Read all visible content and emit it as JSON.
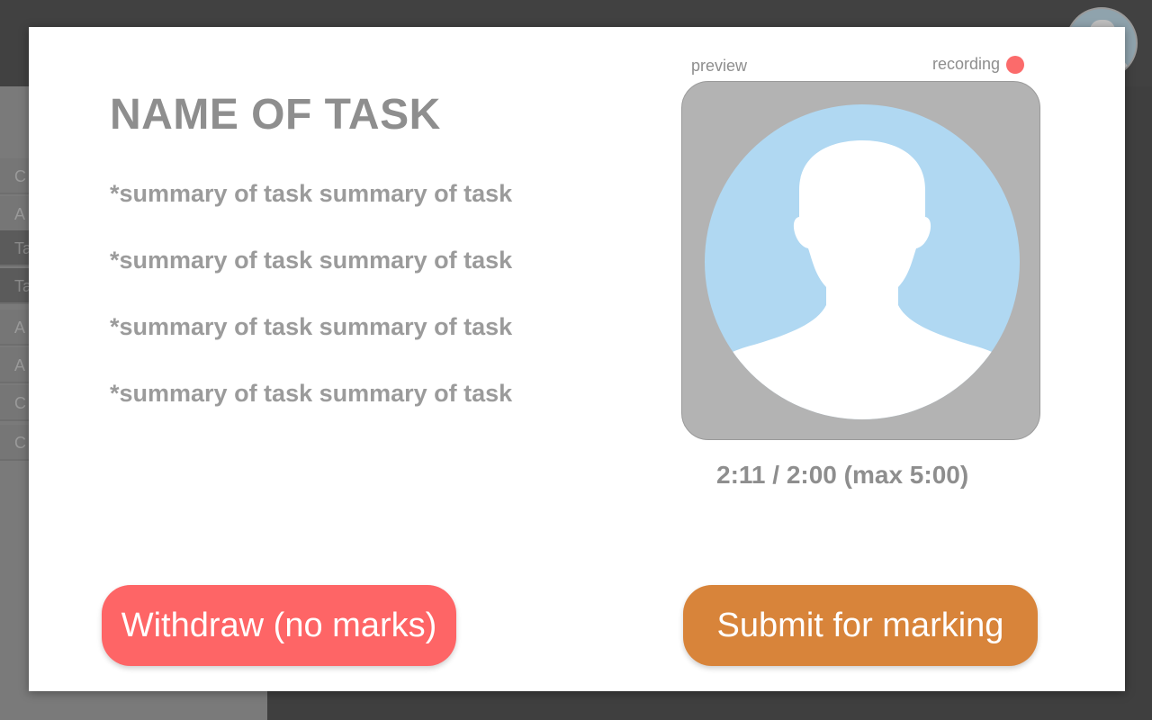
{
  "background": {
    "sidebar_items": [
      {
        "label": "C",
        "active": false
      },
      {
        "label": "A",
        "active": false
      },
      {
        "label": "Ta",
        "active": true
      },
      {
        "label": "Ta",
        "active": true
      },
      {
        "label": "A",
        "active": false
      },
      {
        "label": "A",
        "active": false
      },
      {
        "label": "C",
        "active": false
      },
      {
        "label": "C",
        "active": false
      }
    ]
  },
  "modal": {
    "title": "NAME OF TASK",
    "summary_lines": [
      "*summary of task summary of task",
      "*summary of task summary of task",
      "*summary of task summary of task",
      "*summary of task summary of task"
    ],
    "preview_label": "preview",
    "recording_label": "recording",
    "recording_indicator_color": "#fb6b6b",
    "preview_icon": "person-silhouette-icon",
    "timer": "2:11 / 2:00 (max 5:00)",
    "withdraw_button": {
      "label": "Withdraw (no marks)",
      "color": "#fe6566"
    },
    "submit_button": {
      "label": "Submit for marking",
      "color": "#d8843a"
    }
  }
}
